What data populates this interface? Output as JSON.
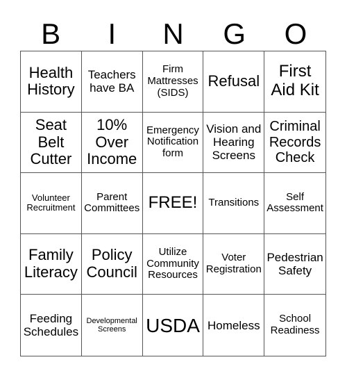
{
  "header": {
    "letters": [
      "B",
      "I",
      "N",
      "G",
      "O"
    ]
  },
  "cells": [
    "Health History",
    "Teachers have BA",
    "Firm Mattresses (SIDS)",
    "Refusal",
    "First Aid Kit",
    "Seat Belt Cutter",
    "10% Over Income",
    "Emergency Notification form",
    "Vision and Hearing Screens",
    "Criminal Records Check",
    "Volunteer Recruitment",
    "Parent Committees",
    "FREE!",
    "Transitions",
    "Self Assessment",
    "Family Literacy",
    "Policy Council",
    "Utilize Community Resources",
    "Voter Registration",
    "Pedestrian Safety",
    "Feeding Schedules",
    "Developmental Screens",
    "USDA",
    "Homeless",
    "School Readiness"
  ]
}
